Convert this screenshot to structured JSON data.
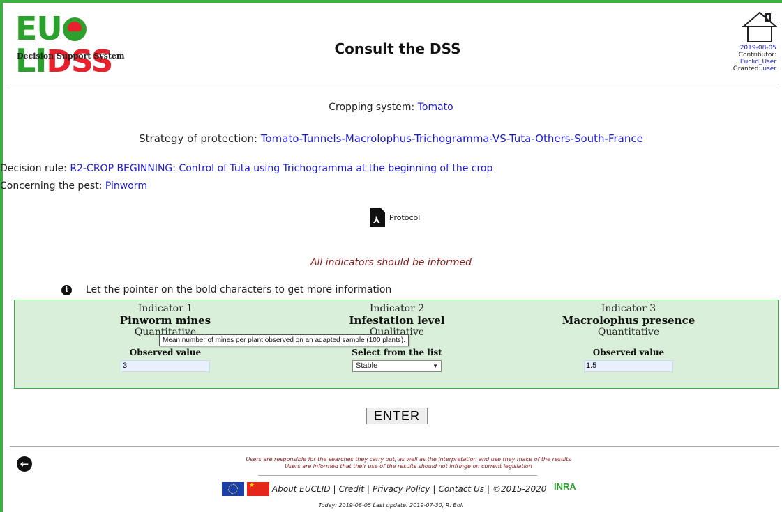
{
  "colors": {
    "frame": "#3cb043",
    "link": "#1a1ad6",
    "warning": "#8b1a1a",
    "panel_bg": "#d9efd9"
  },
  "header": {
    "logo_part1": "EU",
    "logo_part2": "LI",
    "logo_part3": "D",
    "logo_part4": "SS",
    "logo_tagline": "Decision Support System",
    "title": "Consult the DSS",
    "date": "2019-08-05",
    "contributor_label": "Contributor:",
    "contributor": "Euclid_User",
    "granted_label": "Granted:",
    "granted": "user"
  },
  "info": {
    "cropping_label": "Cropping system:",
    "cropping_value": "Tomato",
    "strategy_label": "Strategy of protection:",
    "strategy_value": "Tomato-Tunnels-Macrolophus-Trichogramma-VS-Tuta-Others-South-France",
    "rule_label": "Decision rule:",
    "rule_value": "R2-CROP BEGINNING: Control of Tuta using Trichogramma at the beginning of the crop",
    "pest_label": "Concerning the pest:",
    "pest_value": "Pinworm",
    "protocol": "Protocol",
    "warning": "All indicators should be informed",
    "hint": "Let the pointer on the bold characters to get more information"
  },
  "indicators": [
    {
      "number": "Indicator 1",
      "name": "Pinworm mines",
      "kind": "Quantitative",
      "field_label": "Observed value",
      "value": "3"
    },
    {
      "number": "Indicator 2",
      "name": "Infestation level",
      "kind": "Qualitative",
      "field_label": "Select from the list",
      "value": "Stable"
    },
    {
      "number": "Indicator 3",
      "name": "Macrolophus presence",
      "kind": "Quantitative",
      "field_label": "Observed value",
      "value": "1.5"
    }
  ],
  "tooltip": "Mean number of mines per plant observed on an adapted sample (100 plants).",
  "enter_label": "ENTER",
  "footer": {
    "disclaimer1": "Users are responsible for the searches they carry out, as well as the interpretation and use they make of the results",
    "disclaimer2": "Users are informed that their use of the results should not infringe on current legislation",
    "about": "About EUCLID",
    "credit": "Credit",
    "privacy": "Privacy Policy",
    "contact": "Contact Us",
    "copyright": "©2015-2020",
    "sep": "|",
    "inra": "INRA",
    "today": "Today: 2019-08-05    Last update: 2019-07-30, R. Boll"
  }
}
